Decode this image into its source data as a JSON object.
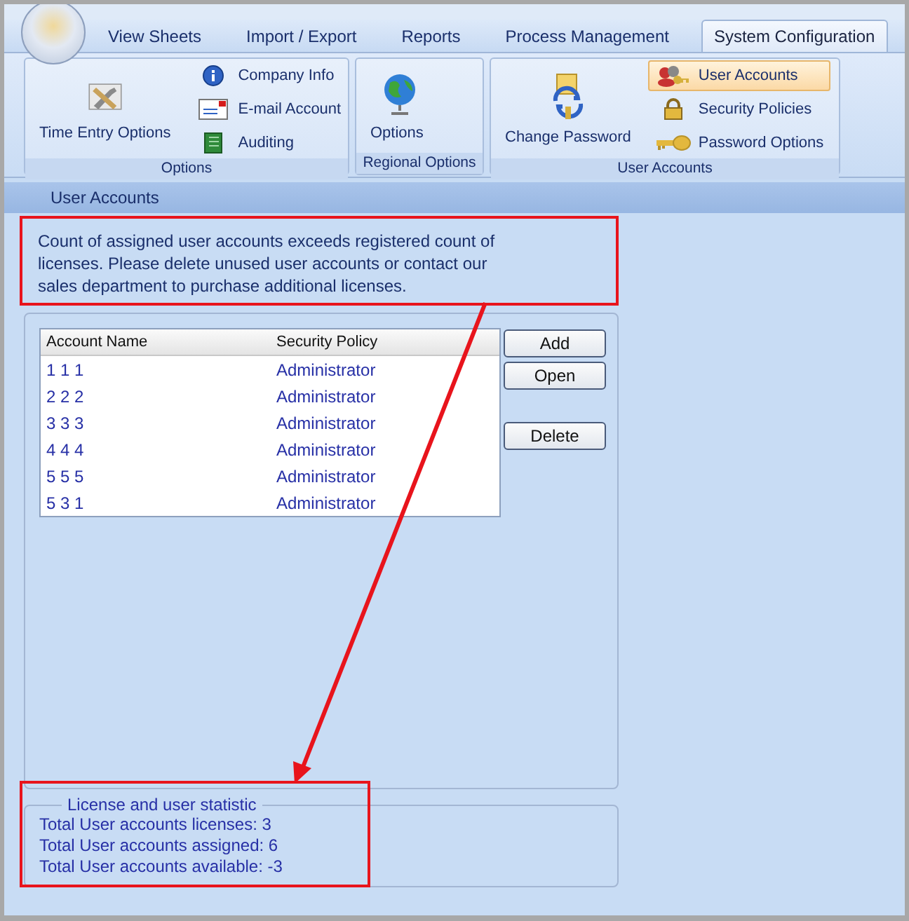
{
  "tabs": [
    {
      "label": "View Sheets",
      "selected": false
    },
    {
      "label": "Import / Export",
      "selected": false
    },
    {
      "label": "Reports",
      "selected": false
    },
    {
      "label": "Process Management",
      "selected": false
    },
    {
      "label": "System Configuration",
      "selected": true
    }
  ],
  "ribbon": {
    "groups": [
      {
        "label": "Options",
        "items": [
          {
            "kind": "large",
            "label": "Time Entry Options",
            "selected": false
          },
          {
            "kind": "small",
            "label": "Company Info",
            "selected": false
          },
          {
            "kind": "small",
            "label": "E-mail Account",
            "selected": false
          },
          {
            "kind": "small",
            "label": "Auditing",
            "selected": false
          }
        ]
      },
      {
        "label": "Regional Options",
        "items": [
          {
            "kind": "large",
            "label": "Options",
            "selected": false
          }
        ]
      },
      {
        "label": "User Accounts",
        "items": [
          {
            "kind": "large",
            "label": "Change Password",
            "selected": false
          },
          {
            "kind": "small",
            "label": "User Accounts",
            "selected": true
          },
          {
            "kind": "small",
            "label": "Security Policies",
            "selected": false
          },
          {
            "kind": "small",
            "label": "Password Options",
            "selected": false
          }
        ]
      }
    ]
  },
  "section_title": "User Accounts",
  "message": {
    "text": "Count of assigned user accounts exceeds registered count of licenses. Please delete unused user accounts or contact our sales department to purchase additional licenses.",
    "callout": true
  },
  "accounts": {
    "columns": [
      "Account Name",
      "Security Policy"
    ],
    "rows": [
      [
        "1 1 1",
        "Administrator"
      ],
      [
        "2 2 2",
        "Administrator"
      ],
      [
        "3 3 3",
        "Administrator"
      ],
      [
        "4 4 4",
        "Administrator"
      ],
      [
        "5 5 5",
        "Administrator"
      ],
      [
        "5 3 1",
        "Administrator"
      ]
    ],
    "buttons": [
      {
        "label": "Add",
        "kind": "add"
      },
      {
        "label": "Open",
        "kind": "open"
      },
      {
        "label": "Delete",
        "kind": "delete"
      }
    ]
  },
  "statistics": {
    "title": "License and user statistic",
    "callout": true,
    "lines": [
      "Total User accounts licenses: 3",
      "Total User accounts assigned: 6",
      "Total User accounts available: -3"
    ]
  }
}
